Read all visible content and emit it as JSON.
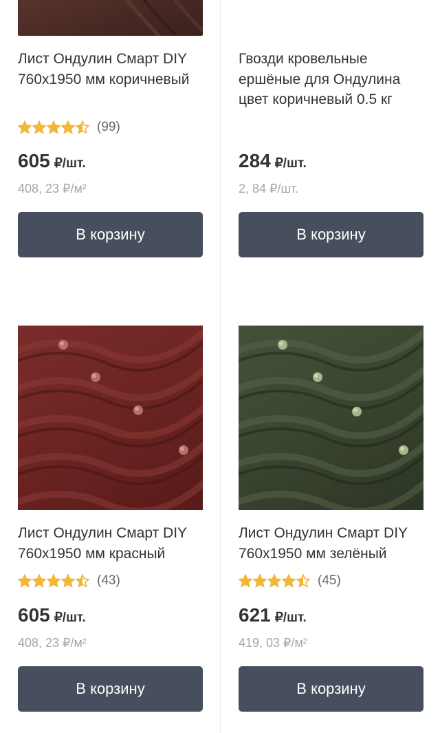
{
  "products": [
    {
      "title": "Лист Ондулин Смарт DIY 760x1950 мм коричневый",
      "rating_count": "(99)",
      "rating": 4.5,
      "price": "605",
      "price_unit": "₽/шт.",
      "unit_price": "408, 23 ₽/м²",
      "button": "В корзину",
      "image_color": "#4a2a25"
    },
    {
      "title": "Гвозди кровельные ершёные для Ондулина цвет коричневый 0.5 кг",
      "price": "284",
      "price_unit": "₽/шт.",
      "unit_price": "2, 84 ₽/шт.",
      "button": "В корзину"
    },
    {
      "title": "Лист Ондулин Смарт DIY 760x1950 мм красный",
      "rating_count": "(43)",
      "rating": 4.5,
      "price": "605",
      "price_unit": "₽/шт.",
      "unit_price": "408, 23 ₽/м²",
      "button": "В корзину",
      "image_color": "#6b2422"
    },
    {
      "title": "Лист Ондулин Смарт DIY 760x1950 мм зелёный",
      "rating_count": "(45)",
      "rating": 4.5,
      "price": "621",
      "price_unit": "₽/шт.",
      "unit_price": "419, 03 ₽/м²",
      "button": "В корзину",
      "image_color": "#3a4530"
    }
  ],
  "colors": {
    "button_bg": "#474e5e",
    "star": "#f2b638",
    "muted_text": "#a6a6a6"
  }
}
